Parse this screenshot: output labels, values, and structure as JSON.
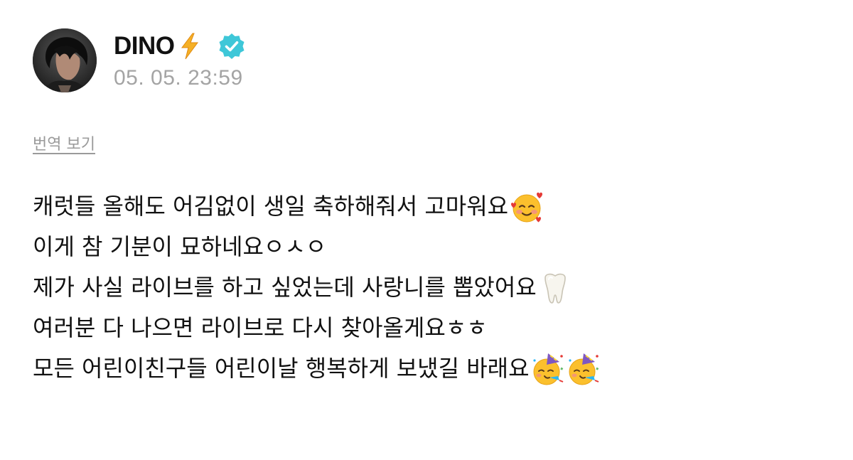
{
  "author": {
    "name": "DINO",
    "name_icon": "lightning-bolt-icon",
    "badge_icon": "verified-badge-icon",
    "avatar_icon": "profile-avatar"
  },
  "post": {
    "timestamp": "05. 05. 23:59",
    "translate_label": "번역 보기",
    "lines": [
      {
        "text": "캐럿들 올해도 어김없이 생일 축하해줘서 고마워요",
        "emojis": [
          "smiling-face-with-hearts-icon"
        ]
      },
      {
        "text": "이게 참 기분이 묘하네요ㅇㅅㅇ",
        "emojis": []
      },
      {
        "text": "제가 사실 라이브를 하고 싶었는데 사랑니를 뽑았어요",
        "emojis": [
          "tooth-icon"
        ]
      },
      {
        "text": "여러분 다 나으면 라이브로 다시 찾아올게요ㅎㅎ",
        "emojis": []
      },
      {
        "text": "모든 어린이친구들 어린이날 행복하게 보냈길 바래요",
        "emojis": [
          "partying-face-icon",
          "partying-face-icon"
        ]
      }
    ]
  },
  "colors": {
    "verified": "#3ec7d8",
    "bolt": "#f5a623",
    "timestamp": "#a4a4a4",
    "translate_link": "#9a9a9a"
  }
}
